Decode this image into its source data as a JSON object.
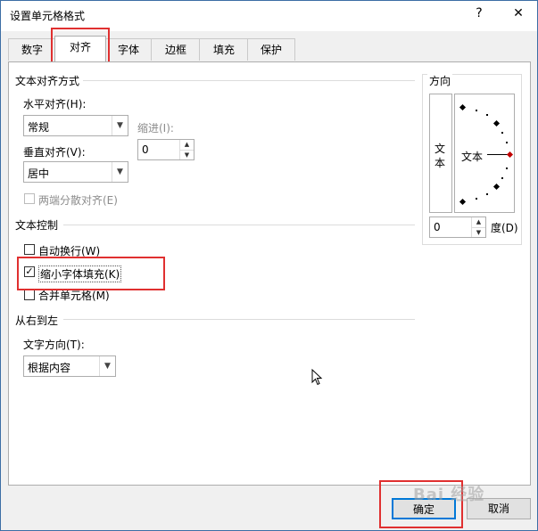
{
  "window": {
    "title": "设置单元格格式",
    "help": "?",
    "close": "✕"
  },
  "tabs": [
    "数字",
    "对齐",
    "字体",
    "边框",
    "填充",
    "保护"
  ],
  "text_alignment": {
    "heading": "文本对齐方式",
    "horizontal_label": "水平对齐(H):",
    "horizontal_value": "常规",
    "indent_label": "缩进(I):",
    "indent_value": "0",
    "vertical_label": "垂直对齐(V):",
    "vertical_value": "居中",
    "distributed_label": "两端分散对齐(E)"
  },
  "text_control": {
    "heading": "文本控制",
    "wrap_label": "自动换行(W)",
    "shrink_label": "缩小字体填充(K)",
    "merge_label": "合并单元格(M)"
  },
  "rtl": {
    "heading": "从右到左",
    "direction_label": "文字方向(T):",
    "direction_value": "根据内容"
  },
  "orientation": {
    "heading": "方向",
    "vertical_text_1": "文",
    "vertical_text_2": "本",
    "arc_text": "文本",
    "degrees_value": "0",
    "degrees_label": "度(D)"
  },
  "buttons": {
    "ok": "确定",
    "cancel": "取消"
  },
  "watermark": "Bai 经验",
  "checks": {
    "wrap": false,
    "shrink": true,
    "merge": false,
    "distributed": false
  },
  "colors": {
    "highlight": "#e03030",
    "diamond": "#c00000"
  }
}
